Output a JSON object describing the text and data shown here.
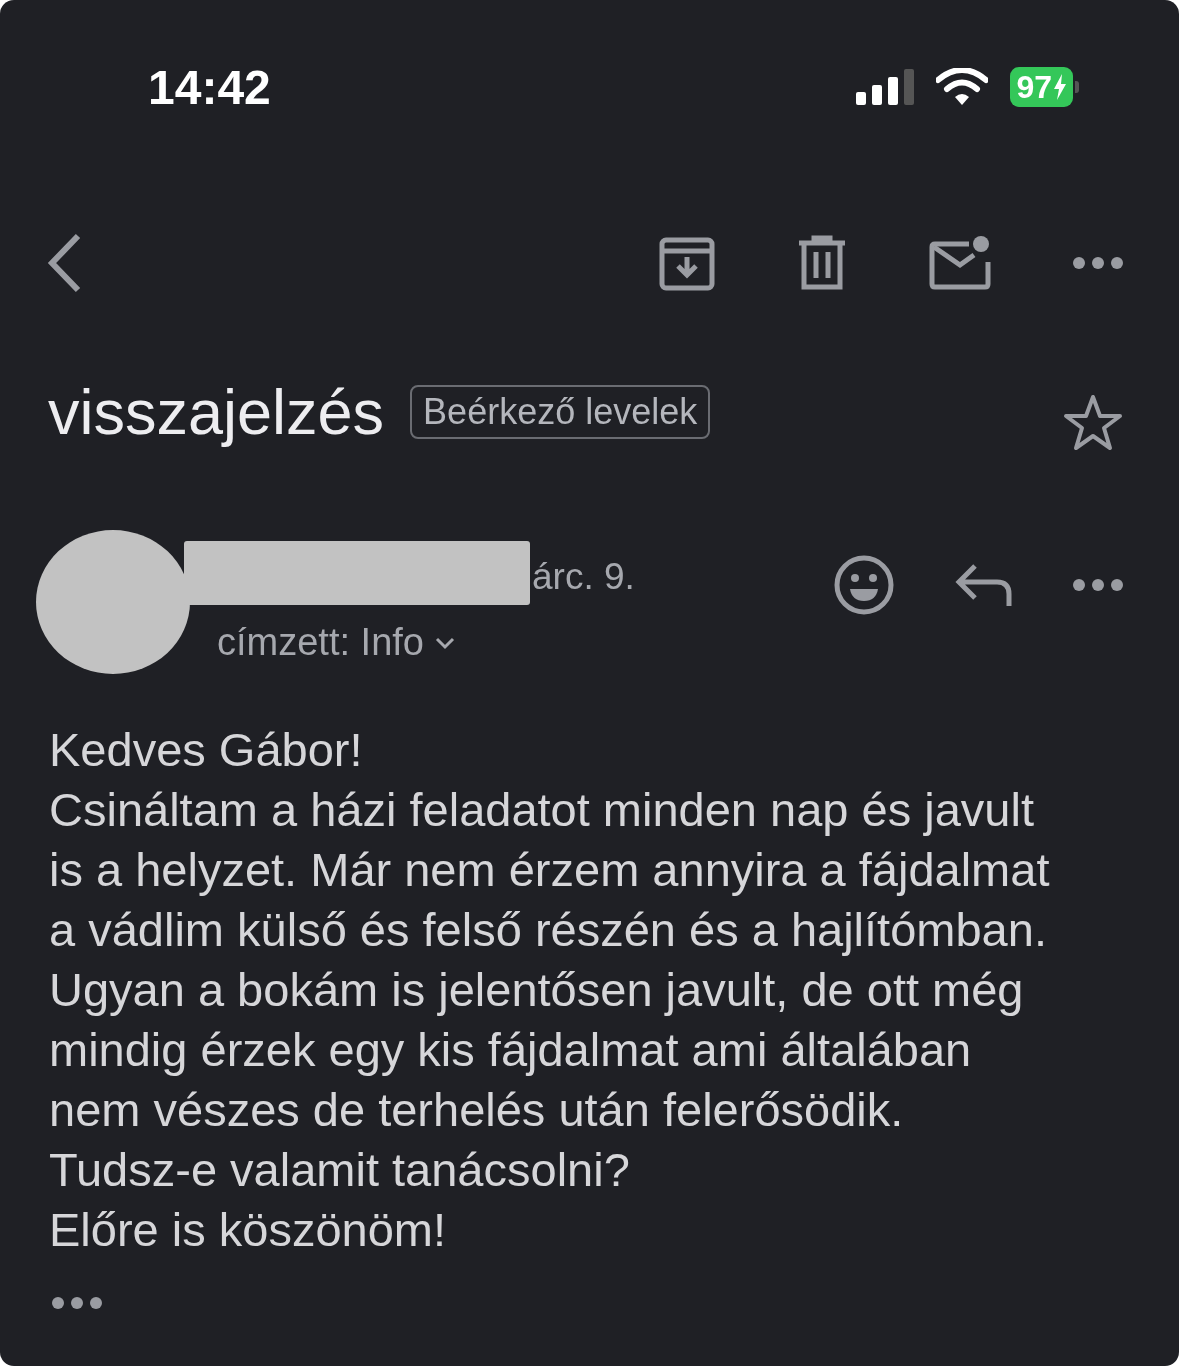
{
  "status_bar": {
    "time": "14:42",
    "battery": "97"
  },
  "email": {
    "subject": "visszajelzés",
    "label": "Beérkező levelek",
    "starred": false,
    "sender": {
      "date": "árc. 9.",
      "recipient": "címzett: Info"
    },
    "body_lines": [
      "Kedves Gábor!",
      "Csináltam a házi feladatot minden nap és javult",
      "is a helyzet. Már nem érzem annyira a fájdalmat",
      "a vádlim külső és felső részén és a hajlítómban.",
      "Ugyan a bokám is jelentősen javult, de ott még",
      "mindig érzek egy kis fájdalmat ami általában",
      "nem vészes de terhelés után felerősödik.",
      "Tudsz-e valamit tanácsolni?",
      "Előre is köszönöm!"
    ]
  }
}
